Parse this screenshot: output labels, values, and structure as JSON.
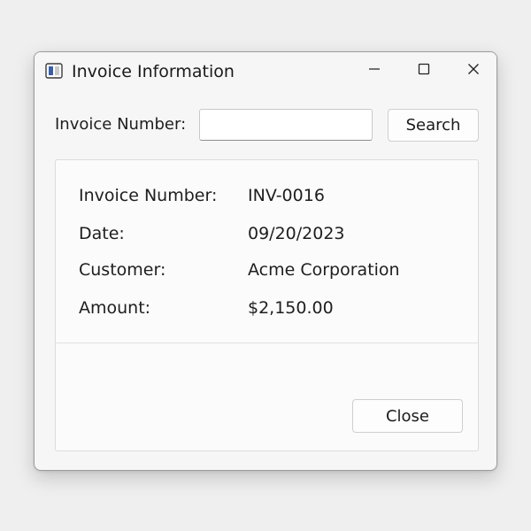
{
  "window": {
    "title": "Invoice Information",
    "app_icon": "form-window-icon",
    "controls": {
      "minimize_icon": "minimize-icon",
      "maximize_icon": "maximize-icon",
      "close_icon": "close-icon"
    }
  },
  "search": {
    "label": "Invoice Number:",
    "value": "",
    "placeholder": "",
    "button_label": "Search"
  },
  "details": {
    "rows": [
      {
        "key": "Invoice Number:",
        "value": "INV-0016"
      },
      {
        "key": "Date:",
        "value": "09/20/2023"
      },
      {
        "key": "Customer:",
        "value": "Acme Corporation"
      },
      {
        "key": "Amount:",
        "value": "$2,150.00"
      }
    ]
  },
  "footer": {
    "close_label": "Close"
  },
  "colors": {
    "background": "#efefef",
    "window": "#f6f6f6",
    "panel": "#fbfbfb",
    "text": "#1b1b1b",
    "icon_accent": "#3a5ea8"
  }
}
